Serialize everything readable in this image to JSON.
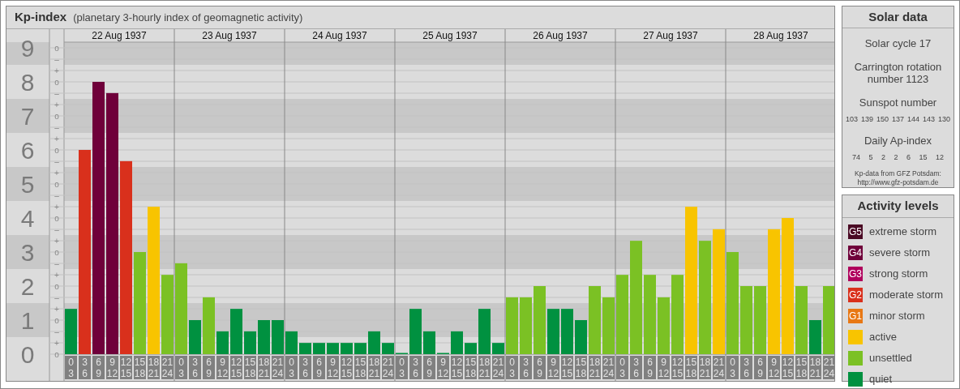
{
  "title": "Kp-index",
  "subtitle": "(planetary 3-hourly index of geomagnetic activity)",
  "days": [
    "22 Aug 1937",
    "23 Aug 1937",
    "24 Aug 1937",
    "25 Aug 1937",
    "26 Aug 1937",
    "27 Aug 1937",
    "28 Aug 1937"
  ],
  "minor_tick_labels": [
    "o",
    "–",
    "+",
    "o",
    "–",
    "+",
    "o",
    "–",
    "+",
    "o",
    "–",
    "+",
    "o",
    "–",
    "+",
    "o",
    "–",
    "+",
    "o",
    "–",
    "+",
    "o",
    "–",
    "+",
    "o",
    "–",
    "+",
    "o"
  ],
  "chart_data": {
    "type": "bar",
    "ylim": [
      0,
      9
    ],
    "grid": true,
    "yticks": [
      {
        "value": 9,
        "label": "9"
      },
      {
        "value": 8,
        "label": "8"
      },
      {
        "value": 7,
        "label": "7"
      },
      {
        "value": 6,
        "label": "6"
      },
      {
        "value": 5,
        "label": "5"
      },
      {
        "value": 4,
        "label": "4"
      },
      {
        "value": 3,
        "label": "3"
      },
      {
        "value": 2,
        "label": "2"
      },
      {
        "value": 1,
        "label": "1"
      },
      {
        "value": 0,
        "label": "0"
      }
    ],
    "categories": [
      "0 3",
      "3 6",
      "6 9",
      "9 12",
      "12 15",
      "15 18",
      "18 21",
      "21 24",
      "0 3",
      "3 6",
      "6 9",
      "9 12",
      "12 15",
      "15 18",
      "18 21",
      "21 24",
      "0 3",
      "3 6",
      "6 9",
      "9 12",
      "12 15",
      "15 18",
      "18 21",
      "21 24",
      "0 3",
      "3 6",
      "6 9",
      "9 12",
      "12 15",
      "15 18",
      "18 21",
      "21 24",
      "0 3",
      "3 6",
      "6 9",
      "9 12",
      "12 15",
      "15 18",
      "18 21",
      "21 24",
      "0 3",
      "3 6",
      "6 9",
      "9 12",
      "12 15",
      "15 18",
      "18 21",
      "21 24",
      "0 3",
      "3 6",
      "6 9",
      "9 12",
      "12 15",
      "15 18",
      "18 21",
      "21 24"
    ],
    "values": [
      1.33,
      6,
      8,
      7.67,
      5.67,
      3,
      4.33,
      2.33,
      2.67,
      1,
      1.67,
      0.67,
      1.33,
      0.67,
      1,
      1,
      0.67,
      0.33,
      0.33,
      0.33,
      0.33,
      0.33,
      0.67,
      0.33,
      0,
      1.33,
      0.67,
      0,
      0.67,
      0.33,
      1.33,
      0.33,
      1.67,
      1.67,
      2,
      1.33,
      1.33,
      1,
      2,
      1.67,
      2.33,
      3.33,
      2.33,
      1.67,
      2.33,
      4.33,
      3.33,
      3.67,
      3,
      2,
      2,
      3.67,
      4,
      2,
      1,
      2
    ]
  },
  "solar": {
    "title": "Solar data",
    "cycle": "Solar cycle 17",
    "rotation": "Carrington rotation number 1123",
    "sunspot_label": "Sunspot number",
    "sunspots": [
      "103",
      "139",
      "150",
      "137",
      "144",
      "143",
      "130"
    ],
    "ap_label": "Daily Ap-index",
    "ap": [
      "74",
      "5",
      "2",
      "2",
      "6",
      "15",
      "12"
    ],
    "source": "Kp-data from GFZ Potsdam:",
    "source_url": "http://www.gfz-potsdam.de"
  },
  "legend": {
    "title": "Activity levels",
    "items": [
      {
        "badge": "G5",
        "label": "extreme storm",
        "color": "#4a0a24"
      },
      {
        "badge": "G4",
        "label": "severe storm",
        "color": "#6f003a"
      },
      {
        "badge": "G3",
        "label": "strong storm",
        "color": "#b0005c"
      },
      {
        "badge": "G2",
        "label": "moderate storm",
        "color": "#d9301c"
      },
      {
        "badge": "G1",
        "label": "minor storm",
        "color": "#e87814"
      },
      {
        "label": "active",
        "color": "#f8c400"
      },
      {
        "label": "unsettled",
        "color": "#7bc124"
      },
      {
        "label": "quiet",
        "color": "#009140"
      }
    ]
  }
}
